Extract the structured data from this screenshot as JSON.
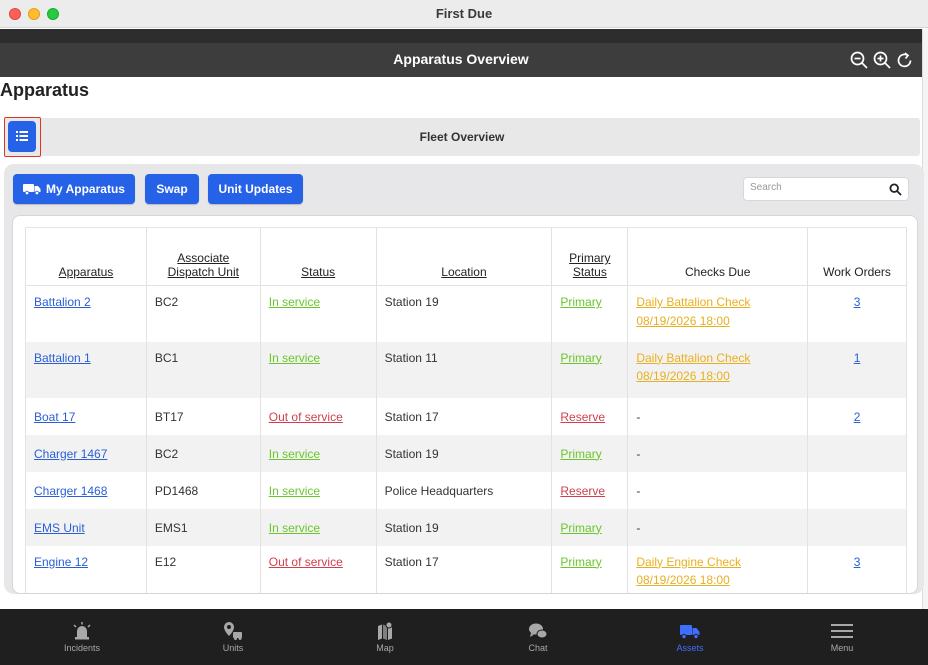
{
  "window": {
    "title": "First Due"
  },
  "header": {
    "title": "Apparatus Overview",
    "icons": [
      "zoom-out-icon",
      "zoom-in-icon",
      "refresh-icon"
    ]
  },
  "page": {
    "title": "Apparatus"
  },
  "fleet": {
    "title": "Fleet Overview",
    "toggle_icon": "list-icon"
  },
  "toolbar": {
    "my_apparatus": "My Apparatus",
    "swap": "Swap",
    "unit_updates": "Unit Updates",
    "search_placeholder": "Search"
  },
  "table": {
    "headers": [
      {
        "line1": "",
        "line2": "Apparatus"
      },
      {
        "line1": "Associate",
        "line2": "Dispatch Unit"
      },
      {
        "line1": "",
        "line2": "Status"
      },
      {
        "line1": "",
        "line2": "Location"
      },
      {
        "line1": "Primary",
        "line2": "Status"
      },
      {
        "line1": "",
        "line2": "Checks Due"
      },
      {
        "line1": "",
        "line2": "Work Orders"
      }
    ],
    "rows": [
      {
        "apparatus": "Battalion 2",
        "unit": "BC2",
        "status": "In service",
        "location": "Station 19",
        "primary": "Primary",
        "check_name": "Daily Battalion Check",
        "check_date": "08/19/2026 18:00",
        "work_orders": "3"
      },
      {
        "apparatus": "Battalion 1",
        "unit": "BC1",
        "status": "In service",
        "location": "Station 11",
        "primary": "Primary",
        "check_name": "Daily Battalion Check",
        "check_date": "08/19/2026 18:00",
        "work_orders": "1"
      },
      {
        "apparatus": "Boat 17",
        "unit": "BT17",
        "status": "Out of service",
        "location": "Station 17",
        "primary": "Reserve",
        "check_name": "-",
        "check_date": "",
        "work_orders": "2"
      },
      {
        "apparatus": "Charger 1467",
        "unit": "BC2",
        "status": "In service",
        "location": "Station 19",
        "primary": "Primary",
        "check_name": "-",
        "check_date": "",
        "work_orders": ""
      },
      {
        "apparatus": "Charger 1468",
        "unit": "PD1468",
        "status": "In service",
        "location": "Police Headquarters",
        "primary": "Reserve",
        "check_name": "-",
        "check_date": "",
        "work_orders": ""
      },
      {
        "apparatus": "EMS Unit",
        "unit": "EMS1",
        "status": "In service",
        "location": "Station 19",
        "primary": "Primary",
        "check_name": "-",
        "check_date": "",
        "work_orders": ""
      },
      {
        "apparatus": "Engine 12",
        "unit": "E12",
        "status": "Out of service",
        "location": "Station 17",
        "primary": "Primary",
        "check_name": "Daily Engine Check",
        "check_date": "08/19/2026 18:00",
        "work_orders": "3"
      }
    ]
  },
  "nav": {
    "items": [
      {
        "label": "Incidents",
        "icon": "alarm-light-icon"
      },
      {
        "label": "Units",
        "icon": "units-icon"
      },
      {
        "label": "Map",
        "icon": "map-icon"
      },
      {
        "label": "Chat",
        "icon": "chat-icon"
      },
      {
        "label": "Assets",
        "icon": "truck-icon"
      },
      {
        "label": "Menu",
        "icon": "hamburger-menu-icon"
      }
    ],
    "active": "Assets"
  },
  "colors": {
    "accent": "#2662e8",
    "in_service": "#6ac62c",
    "out_of_service": "#d13f4e",
    "check_due": "#e8b020",
    "nav_active": "#3f6fff"
  }
}
